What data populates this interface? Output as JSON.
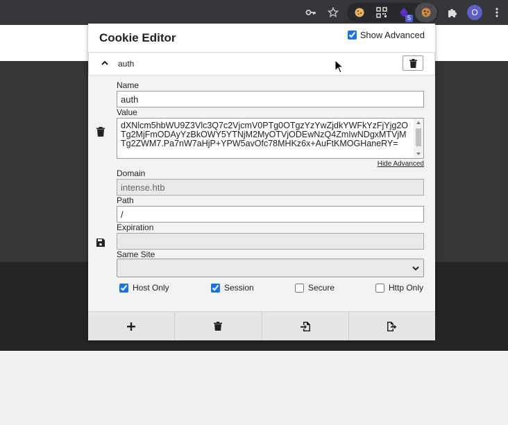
{
  "browser": {
    "toolbar_icons": [
      "key-icon",
      "star-icon",
      "cookie-extension-icon",
      "qr-code-icon",
      "purple-extension-icon",
      "cookie-editor-icon",
      "puzzle-icon",
      "profile-avatar",
      "kebab-menu-icon"
    ],
    "extension_badge": "5",
    "avatar_letter": "O"
  },
  "popup": {
    "title": "Cookie Editor",
    "show_advanced_label": "Show Advanced",
    "show_advanced_checked": true,
    "cookie": {
      "name_header": "auth",
      "name_label": "Name",
      "name_value": "auth",
      "value_label": "Value",
      "value_text": "dXNlcm5hbWU9Z3Vlc3Q7c2VjcmV0PTg0OTgzYzYwZjdkYWFkYzFjYjg2OTg2MjFmODAyYzBkOWY5YTNjM2MyOTVjODEwNzQ4ZmIwNDgxMTVjMTg2ZWM7.Pa7nW7aHjP+YPW5avOfc78MHKz6x+AuFtKMOGHaneRY=",
      "hide_advanced_label": "Hide Advanced",
      "domain_label": "Domain",
      "domain_value": "intense.htb",
      "path_label": "Path",
      "path_value": "/",
      "expiration_label": "Expiration",
      "expiration_value": "",
      "same_site_label": "Same Site",
      "same_site_value": "",
      "flags": [
        {
          "label": "Host Only",
          "checked": true
        },
        {
          "label": "Session",
          "checked": true
        },
        {
          "label": "Secure",
          "checked": false
        },
        {
          "label": "Http Only",
          "checked": false
        }
      ]
    },
    "footer_buttons": [
      "add-cookie",
      "delete-all",
      "import",
      "export"
    ]
  },
  "colors": {
    "accent": "#1a73e8",
    "chrome_bar": "#35363a",
    "avatar": "#5b5fc7"
  }
}
